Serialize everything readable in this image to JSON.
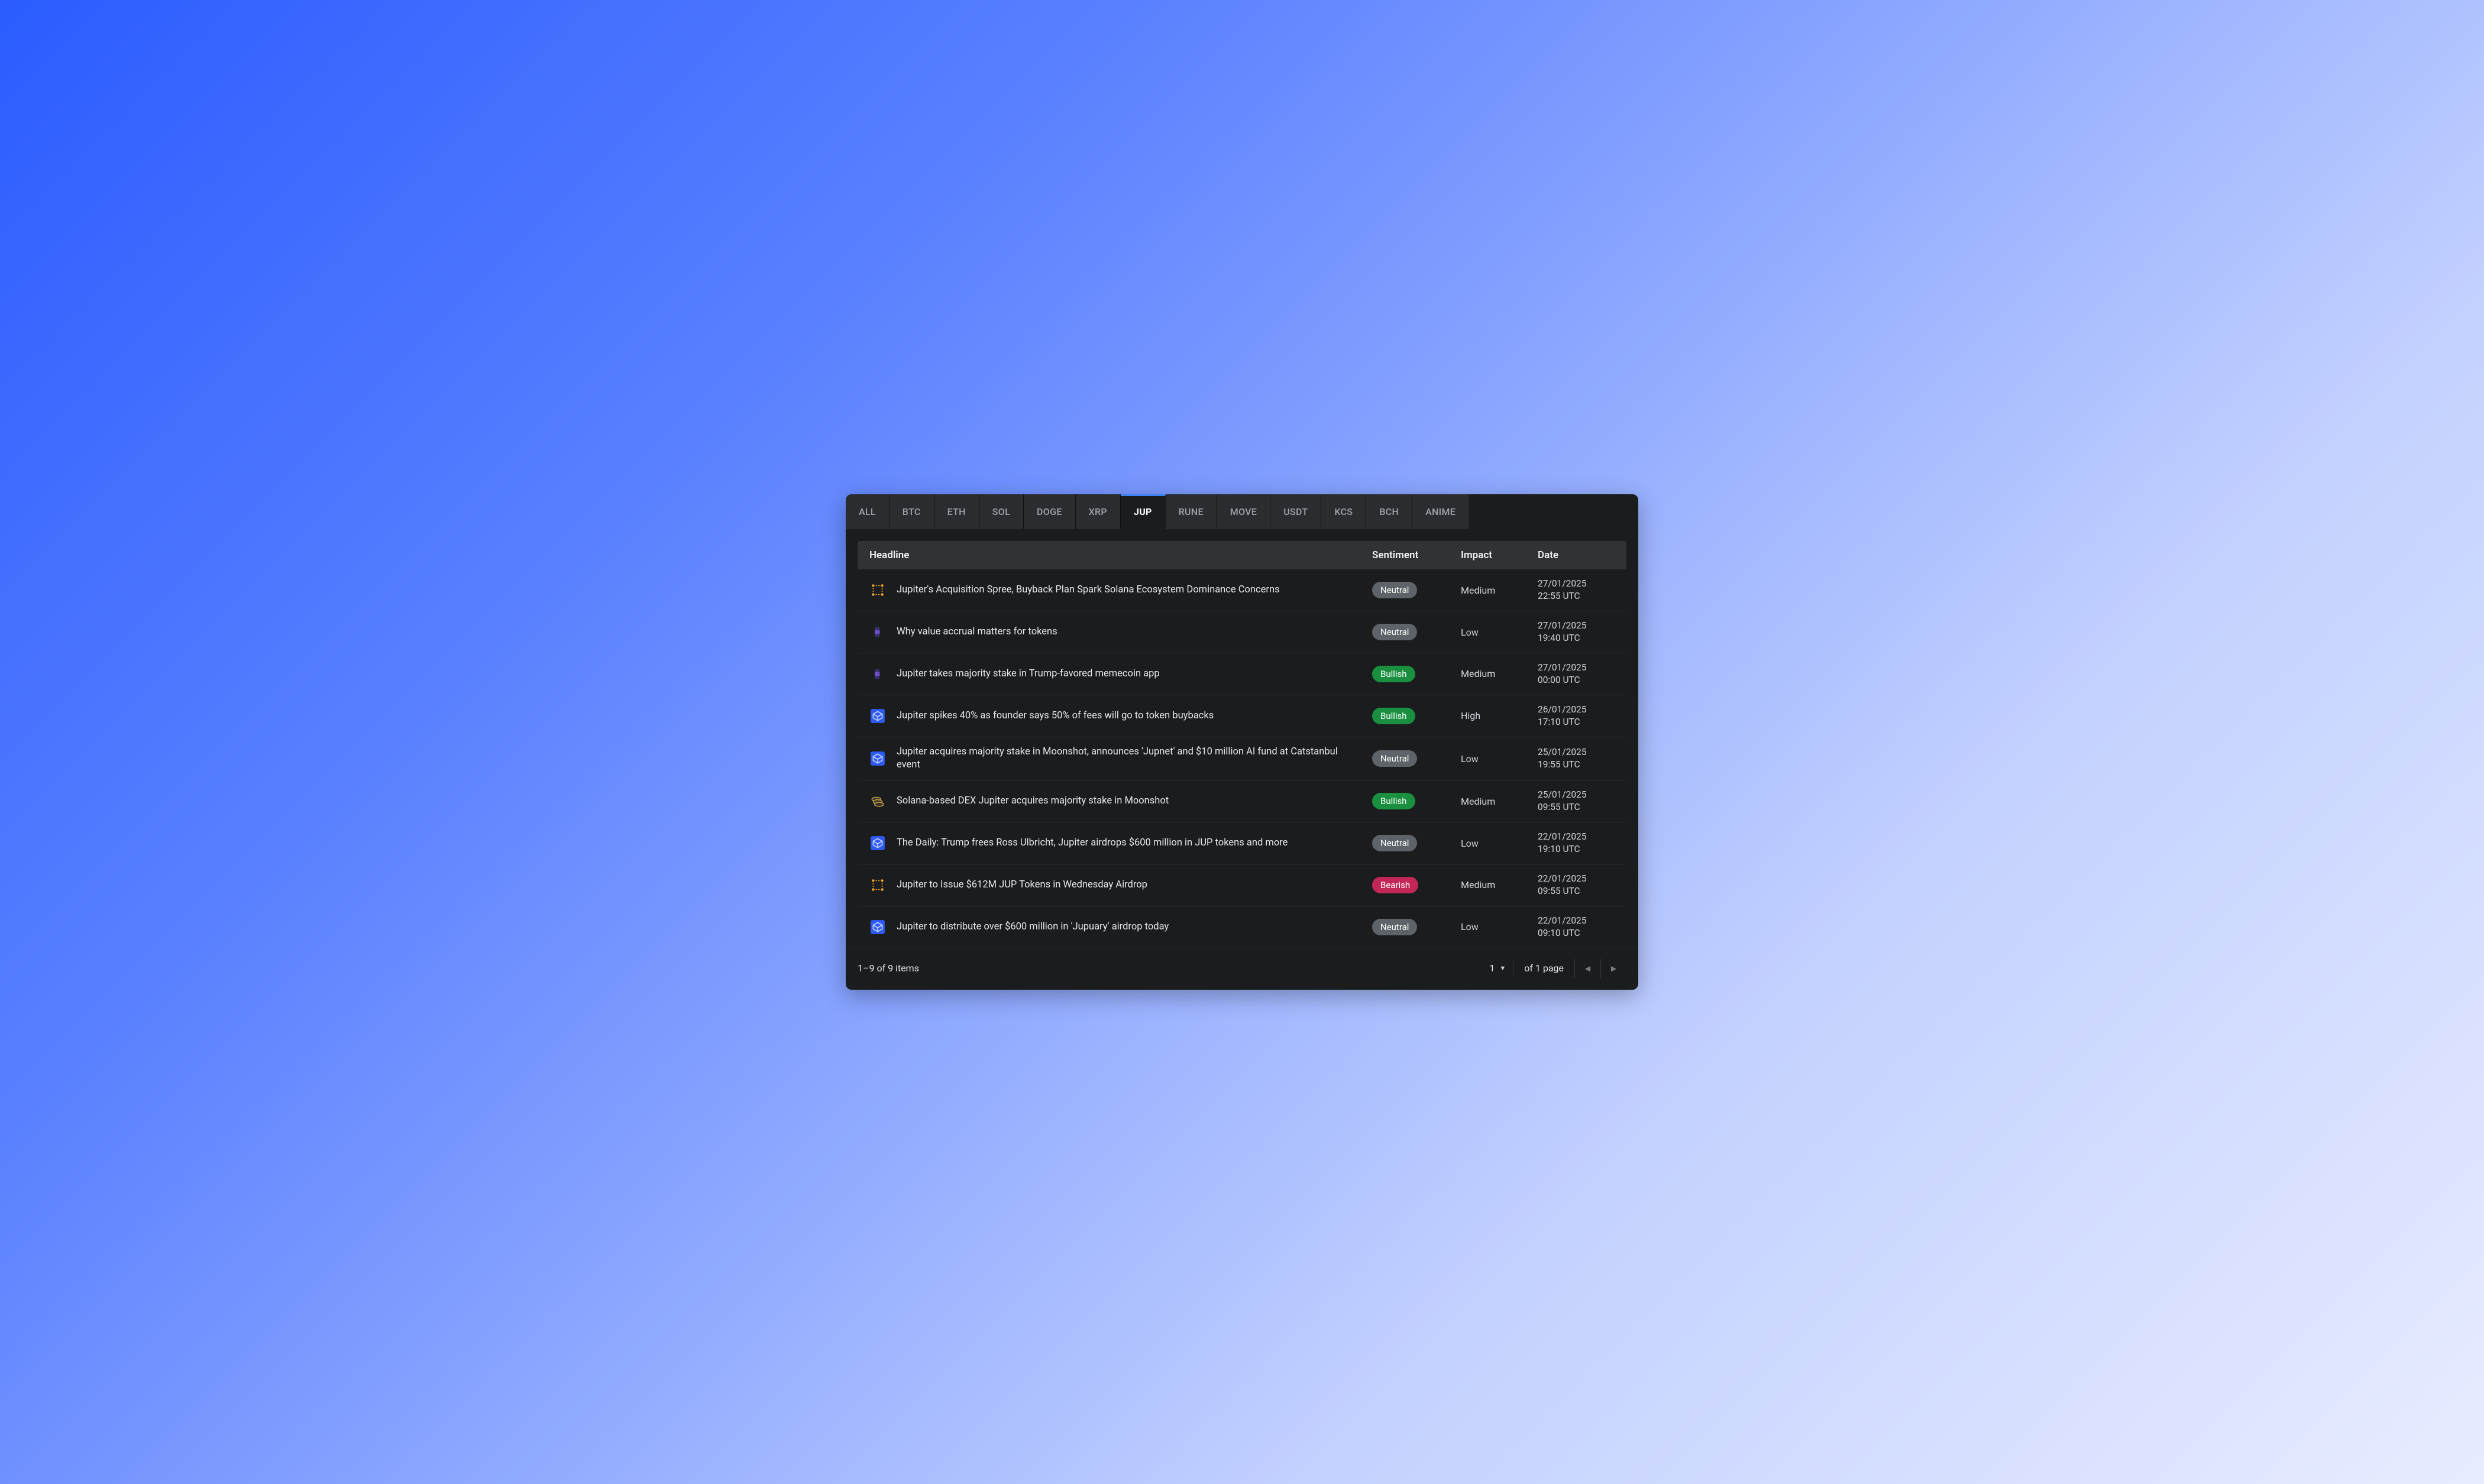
{
  "tabs": [
    {
      "label": "ALL",
      "active": false
    },
    {
      "label": "BTC",
      "active": false
    },
    {
      "label": "ETH",
      "active": false
    },
    {
      "label": "SOL",
      "active": false
    },
    {
      "label": "DOGE",
      "active": false
    },
    {
      "label": "XRP",
      "active": false
    },
    {
      "label": "JUP",
      "active": true
    },
    {
      "label": "RUNE",
      "active": false
    },
    {
      "label": "MOVE",
      "active": false
    },
    {
      "label": "USDT",
      "active": false
    },
    {
      "label": "KCS",
      "active": false
    },
    {
      "label": "BCH",
      "active": false
    },
    {
      "label": "ANIME",
      "active": false
    }
  ],
  "columns": {
    "headline": "Headline",
    "sentiment": "Sentiment",
    "impact": "Impact",
    "date": "Date"
  },
  "rows": [
    {
      "source_icon": "source-orange-grid",
      "headline": "Jupiter's Acquisition Spree, Buyback Plan Spark Solana Ecosystem Dominance Concerns",
      "sentiment": "Neutral",
      "impact": "Medium",
      "date_line1": "27/01/2025",
      "date_line2": "22:55 UTC"
    },
    {
      "source_icon": "source-purple-bar",
      "headline": "Why value accrual matters for tokens",
      "sentiment": "Neutral",
      "impact": "Low",
      "date_line1": "27/01/2025",
      "date_line2": "19:40 UTC"
    },
    {
      "source_icon": "source-purple-bar",
      "headline": "Jupiter takes majority stake in Trump-favored memecoin app",
      "sentiment": "Bullish",
      "impact": "Medium",
      "date_line1": "27/01/2025",
      "date_line2": "00:00 UTC"
    },
    {
      "source_icon": "source-blue-cube",
      "headline": "Jupiter spikes 40% as founder says 50% of fees will go to token buybacks",
      "sentiment": "Bullish",
      "impact": "High",
      "date_line1": "26/01/2025",
      "date_line2": "17:10 UTC"
    },
    {
      "source_icon": "source-blue-cube",
      "headline": "Jupiter acquires majority stake in Moonshot, announces 'Jupnet' and $10 million AI fund at Catstanbul event",
      "sentiment": "Neutral",
      "impact": "Low",
      "date_line1": "25/01/2025",
      "date_line2": "19:55 UTC"
    },
    {
      "source_icon": "source-coin-stack",
      "headline": "Solana-based DEX Jupiter acquires majority stake in Moonshot",
      "sentiment": "Bullish",
      "impact": "Medium",
      "date_line1": "25/01/2025",
      "date_line2": "09:55 UTC"
    },
    {
      "source_icon": "source-blue-cube",
      "headline": "The Daily: Trump frees Ross Ulbricht, Jupiter airdrops $600 million in JUP tokens and more",
      "sentiment": "Neutral",
      "impact": "Low",
      "date_line1": "22/01/2025",
      "date_line2": "19:10 UTC"
    },
    {
      "source_icon": "source-orange-grid",
      "headline": "Jupiter to Issue $612M JUP Tokens in Wednesday Airdrop",
      "sentiment": "Bearish",
      "impact": "Medium",
      "date_line1": "22/01/2025",
      "date_line2": "09:55 UTC"
    },
    {
      "source_icon": "source-blue-cube",
      "headline": "Jupiter to distribute over $600 million in 'Jupuary' airdrop today",
      "sentiment": "Neutral",
      "impact": "Low",
      "date_line1": "22/01/2025",
      "date_line2": "09:10 UTC"
    }
  ],
  "footer": {
    "items_summary": "1–9 of 9 items",
    "current_page": "1",
    "page_total_label": "of 1 page"
  },
  "colors": {
    "neutral_pill": "#5d6368",
    "bullish_pill": "#198f3f",
    "bearish_pill": "#c22758",
    "active_tab_border": "#3b82f6"
  }
}
